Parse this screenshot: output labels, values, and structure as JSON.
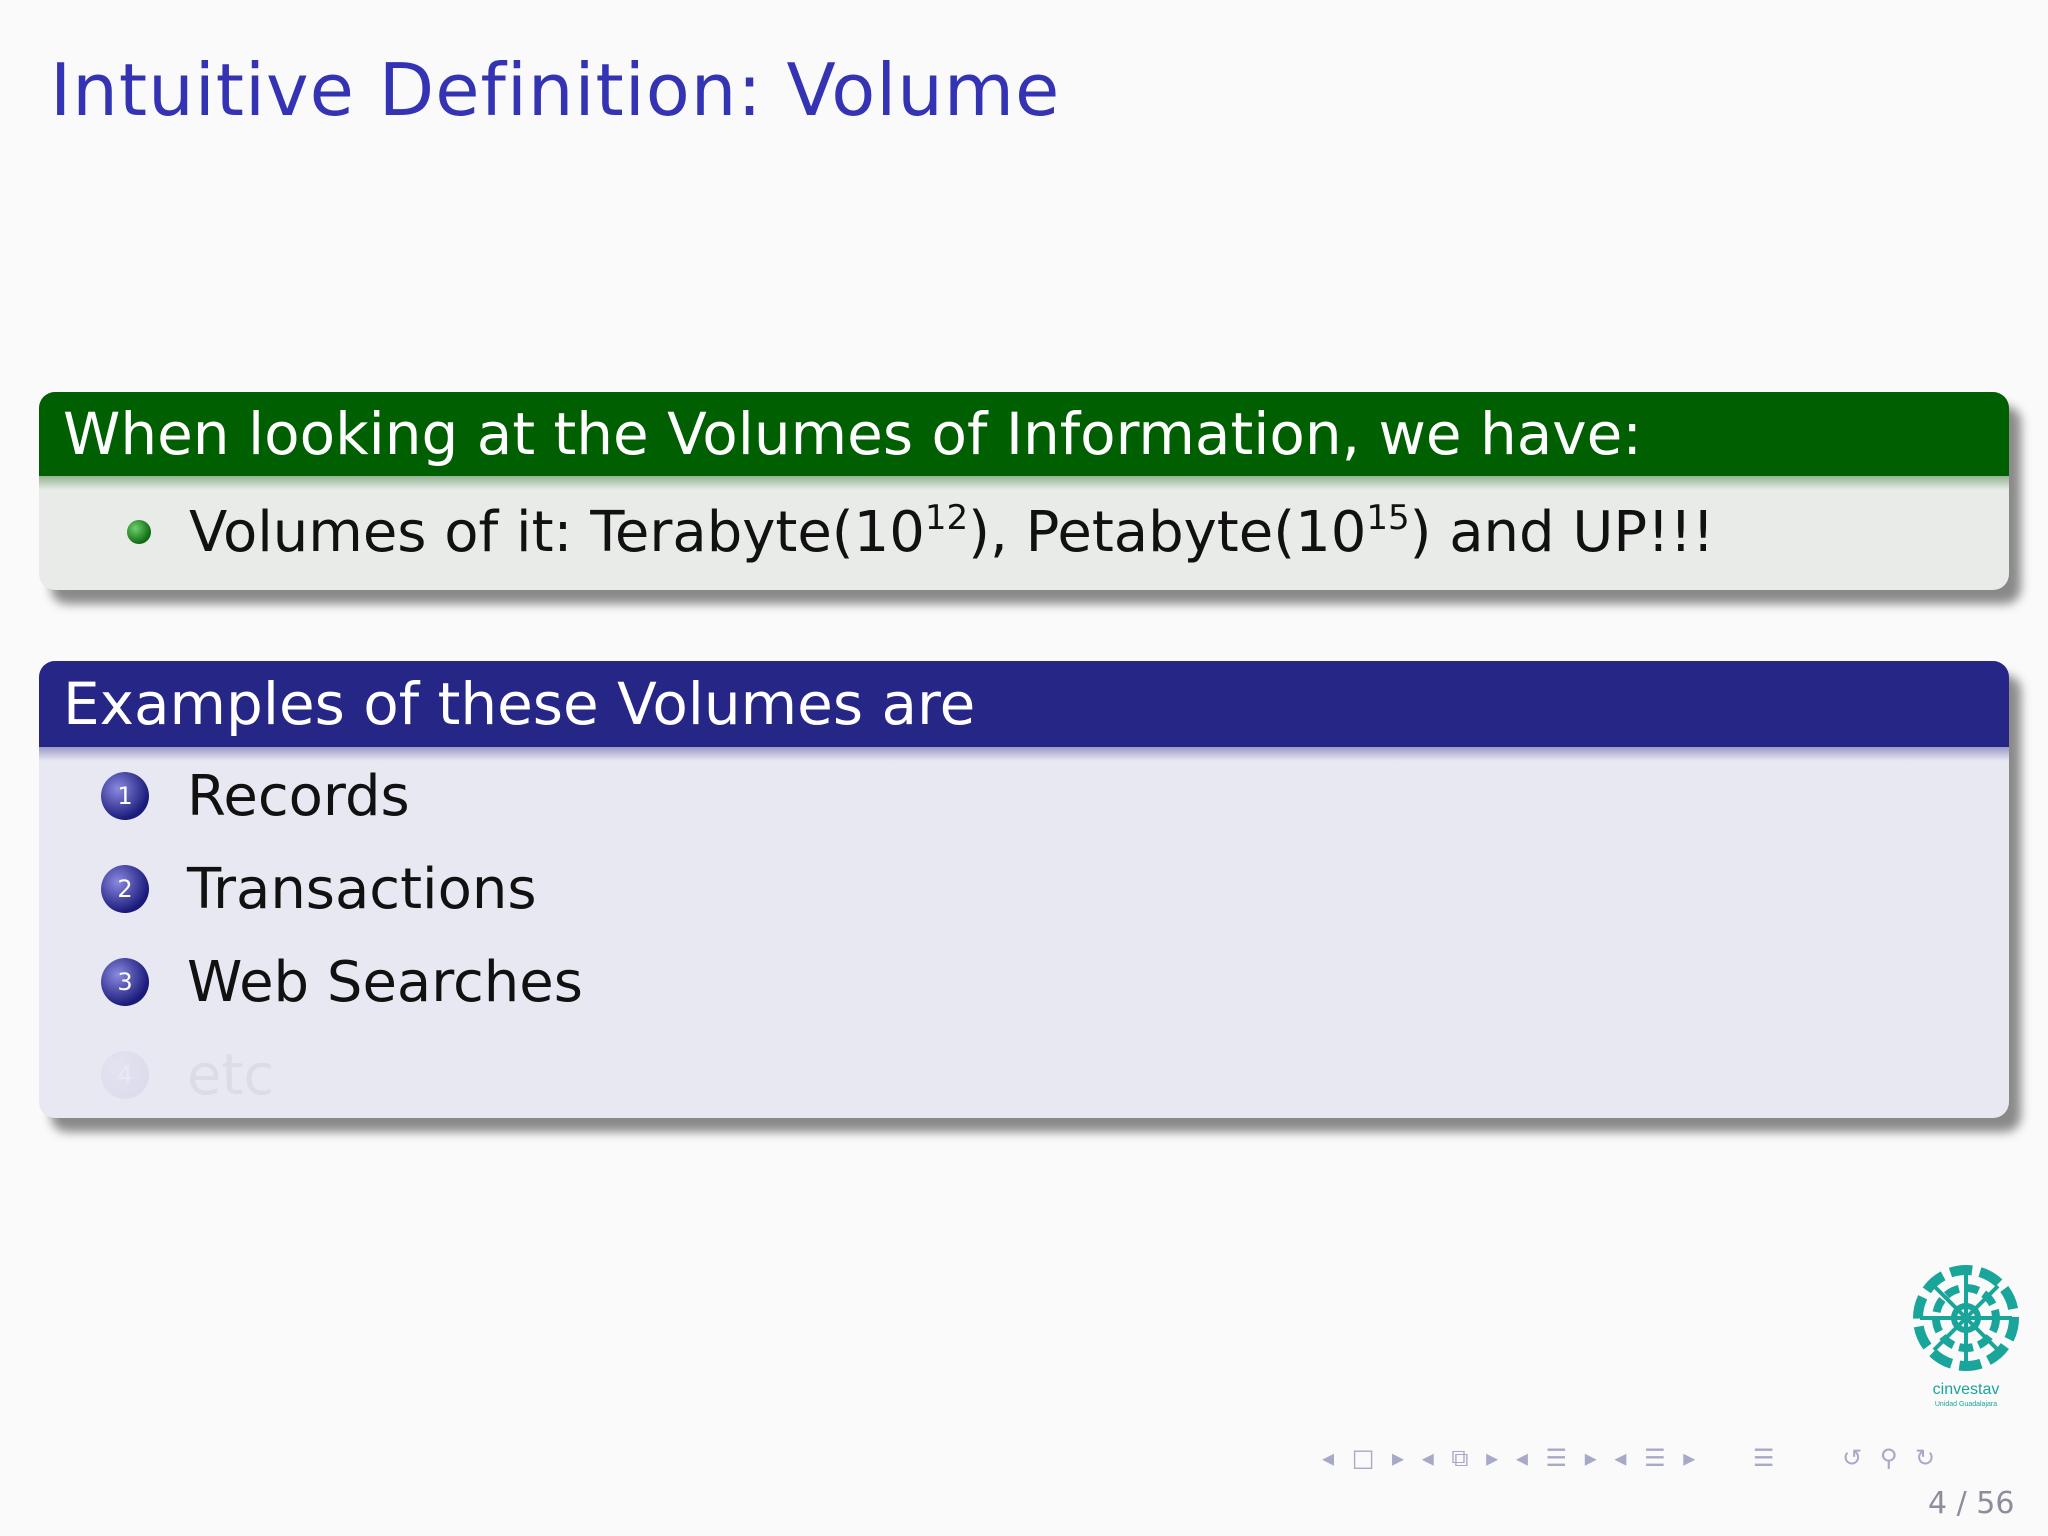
{
  "slide": {
    "title": "Intuitive Definition: Volume"
  },
  "block1": {
    "heading": "When looking at the Volumes of Information, we have:",
    "bullet": {
      "text_a": "Volumes of it: Terabyte(10",
      "exp1": "12",
      "text_b": "), Petabyte(10",
      "exp2": "15",
      "text_c": ") and UP!!!"
    }
  },
  "block2": {
    "heading": "Examples of these Volumes are",
    "items": [
      {
        "num": "1",
        "label": "Records"
      },
      {
        "num": "2",
        "label": "Transactions"
      },
      {
        "num": "3",
        "label": "Web Searches"
      },
      {
        "num": "4",
        "label": "etc"
      }
    ]
  },
  "logo": {
    "name": "cinvestav",
    "subtitle": "Unidad Guadalajara",
    "color": "#1aa59a"
  },
  "nav": {
    "icons": [
      "arrow-left-icon",
      "frame-icon",
      "arrow-right-icon",
      "subsection-icon",
      "section-icon",
      "align-icon",
      "back-icon",
      "search-icon",
      "forward-icon"
    ]
  },
  "page": {
    "current": "4",
    "total": "56",
    "separator": "/"
  },
  "colors": {
    "title": "#3333b3",
    "block1_header": "#005f00",
    "block2_header": "#262686"
  }
}
